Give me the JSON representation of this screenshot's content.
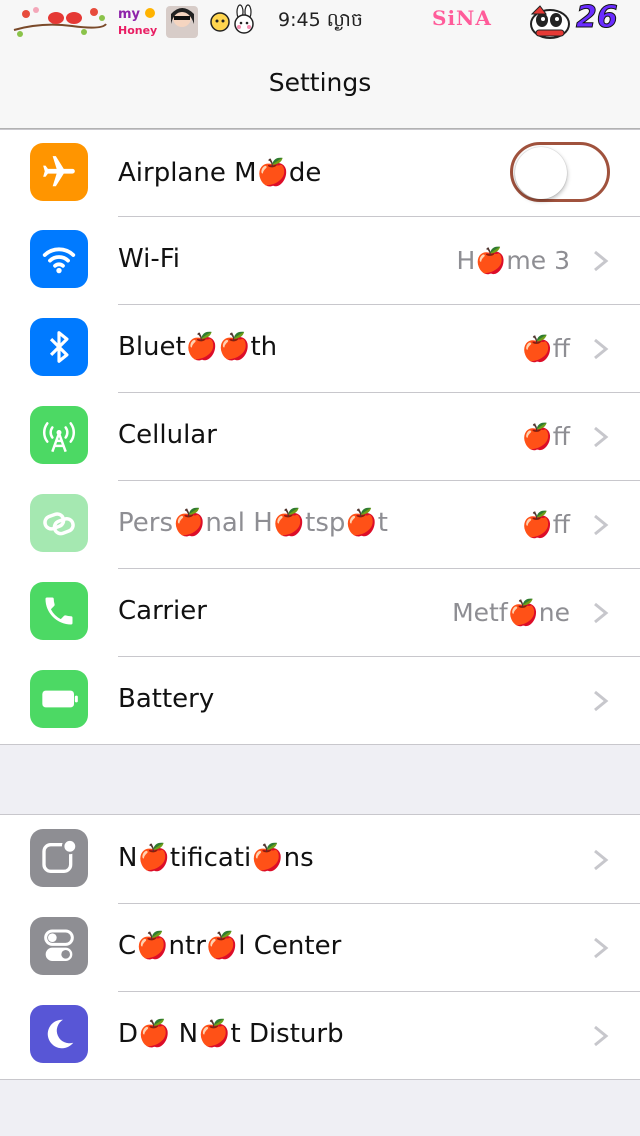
{
  "status_bar": {
    "time": "9:45 ល្ងាច",
    "decor_text_honey": "my Honey",
    "decor_text_sina": "SiNA",
    "battery_level": "26"
  },
  "nav": {
    "title": "Settings"
  },
  "colors": {
    "airplane": "#ff9500",
    "wifi": "#007aff",
    "bluetooth": "#007aff",
    "cellular": "#4cd964",
    "hotspot": "#a5e8b1",
    "carrier": "#4cd964",
    "battery": "#4cd964",
    "notifications": "#8e8e93",
    "control_center": "#8e8e93",
    "dnd": "#5856d6",
    "toggle_border": "#a0523d"
  },
  "group1": {
    "airplane": {
      "label": "Airplane M🍎de",
      "icon": "airplane-icon",
      "toggle_on": false
    },
    "wifi": {
      "label": "Wi-Fi",
      "value": "H🍎me 3",
      "icon": "wifi-icon"
    },
    "bluetooth": {
      "label": "Bluet🍎🍎th",
      "value": "🍎ff",
      "icon": "bluetooth-icon"
    },
    "cellular": {
      "label": "Cellular",
      "value": "🍎ff",
      "icon": "cellular-antenna-icon"
    },
    "hotspot": {
      "label": "Pers🍎nal H🍎tsp🍎t",
      "value": "🍎ff",
      "icon": "hotspot-link-icon"
    },
    "carrier": {
      "label": "Carrier",
      "value": "Metf🍎ne",
      "icon": "phone-icon"
    },
    "battery": {
      "label": "Battery",
      "icon": "battery-icon"
    }
  },
  "group2": {
    "notifications": {
      "label": "N🍎tificati🍎ns",
      "icon": "notifications-icon"
    },
    "control_center": {
      "label": "C🍎ntr🍎l Center",
      "icon": "control-center-icon"
    },
    "dnd": {
      "label": "D🍎 N🍎t Disturb",
      "icon": "moon-icon"
    }
  }
}
